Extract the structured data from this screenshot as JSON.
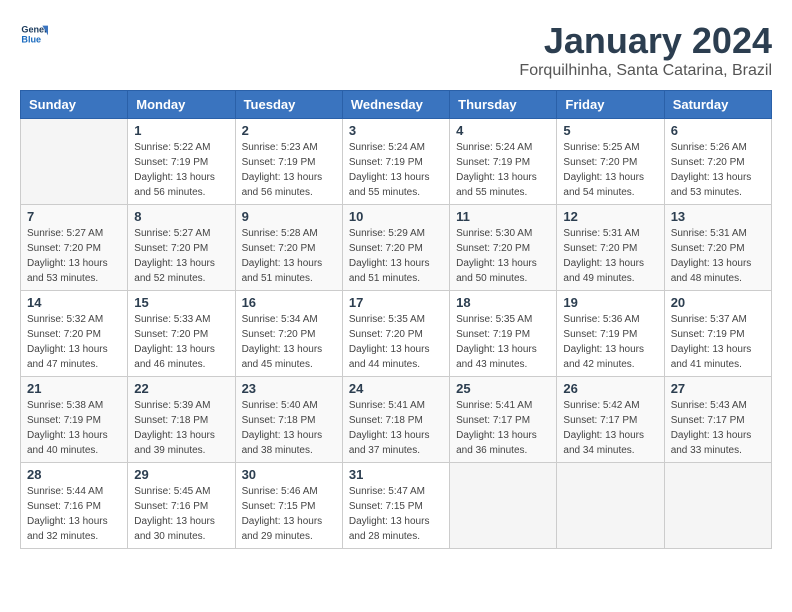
{
  "logo": {
    "line1": "General",
    "line2": "Blue"
  },
  "title": "January 2024",
  "subtitle": "Forquilhinha, Santa Catarina, Brazil",
  "headers": [
    "Sunday",
    "Monday",
    "Tuesday",
    "Wednesday",
    "Thursday",
    "Friday",
    "Saturday"
  ],
  "weeks": [
    [
      {
        "day": "",
        "sunrise": "",
        "sunset": "",
        "daylight": ""
      },
      {
        "day": "1",
        "sunrise": "Sunrise: 5:22 AM",
        "sunset": "Sunset: 7:19 PM",
        "daylight": "Daylight: 13 hours and 56 minutes."
      },
      {
        "day": "2",
        "sunrise": "Sunrise: 5:23 AM",
        "sunset": "Sunset: 7:19 PM",
        "daylight": "Daylight: 13 hours and 56 minutes."
      },
      {
        "day": "3",
        "sunrise": "Sunrise: 5:24 AM",
        "sunset": "Sunset: 7:19 PM",
        "daylight": "Daylight: 13 hours and 55 minutes."
      },
      {
        "day": "4",
        "sunrise": "Sunrise: 5:24 AM",
        "sunset": "Sunset: 7:19 PM",
        "daylight": "Daylight: 13 hours and 55 minutes."
      },
      {
        "day": "5",
        "sunrise": "Sunrise: 5:25 AM",
        "sunset": "Sunset: 7:20 PM",
        "daylight": "Daylight: 13 hours and 54 minutes."
      },
      {
        "day": "6",
        "sunrise": "Sunrise: 5:26 AM",
        "sunset": "Sunset: 7:20 PM",
        "daylight": "Daylight: 13 hours and 53 minutes."
      }
    ],
    [
      {
        "day": "7",
        "sunrise": "Sunrise: 5:27 AM",
        "sunset": "Sunset: 7:20 PM",
        "daylight": "Daylight: 13 hours and 53 minutes."
      },
      {
        "day": "8",
        "sunrise": "Sunrise: 5:27 AM",
        "sunset": "Sunset: 7:20 PM",
        "daylight": "Daylight: 13 hours and 52 minutes."
      },
      {
        "day": "9",
        "sunrise": "Sunrise: 5:28 AM",
        "sunset": "Sunset: 7:20 PM",
        "daylight": "Daylight: 13 hours and 51 minutes."
      },
      {
        "day": "10",
        "sunrise": "Sunrise: 5:29 AM",
        "sunset": "Sunset: 7:20 PM",
        "daylight": "Daylight: 13 hours and 51 minutes."
      },
      {
        "day": "11",
        "sunrise": "Sunrise: 5:30 AM",
        "sunset": "Sunset: 7:20 PM",
        "daylight": "Daylight: 13 hours and 50 minutes."
      },
      {
        "day": "12",
        "sunrise": "Sunrise: 5:31 AM",
        "sunset": "Sunset: 7:20 PM",
        "daylight": "Daylight: 13 hours and 49 minutes."
      },
      {
        "day": "13",
        "sunrise": "Sunrise: 5:31 AM",
        "sunset": "Sunset: 7:20 PM",
        "daylight": "Daylight: 13 hours and 48 minutes."
      }
    ],
    [
      {
        "day": "14",
        "sunrise": "Sunrise: 5:32 AM",
        "sunset": "Sunset: 7:20 PM",
        "daylight": "Daylight: 13 hours and 47 minutes."
      },
      {
        "day": "15",
        "sunrise": "Sunrise: 5:33 AM",
        "sunset": "Sunset: 7:20 PM",
        "daylight": "Daylight: 13 hours and 46 minutes."
      },
      {
        "day": "16",
        "sunrise": "Sunrise: 5:34 AM",
        "sunset": "Sunset: 7:20 PM",
        "daylight": "Daylight: 13 hours and 45 minutes."
      },
      {
        "day": "17",
        "sunrise": "Sunrise: 5:35 AM",
        "sunset": "Sunset: 7:20 PM",
        "daylight": "Daylight: 13 hours and 44 minutes."
      },
      {
        "day": "18",
        "sunrise": "Sunrise: 5:35 AM",
        "sunset": "Sunset: 7:19 PM",
        "daylight": "Daylight: 13 hours and 43 minutes."
      },
      {
        "day": "19",
        "sunrise": "Sunrise: 5:36 AM",
        "sunset": "Sunset: 7:19 PM",
        "daylight": "Daylight: 13 hours and 42 minutes."
      },
      {
        "day": "20",
        "sunrise": "Sunrise: 5:37 AM",
        "sunset": "Sunset: 7:19 PM",
        "daylight": "Daylight: 13 hours and 41 minutes."
      }
    ],
    [
      {
        "day": "21",
        "sunrise": "Sunrise: 5:38 AM",
        "sunset": "Sunset: 7:19 PM",
        "daylight": "Daylight: 13 hours and 40 minutes."
      },
      {
        "day": "22",
        "sunrise": "Sunrise: 5:39 AM",
        "sunset": "Sunset: 7:18 PM",
        "daylight": "Daylight: 13 hours and 39 minutes."
      },
      {
        "day": "23",
        "sunrise": "Sunrise: 5:40 AM",
        "sunset": "Sunset: 7:18 PM",
        "daylight": "Daylight: 13 hours and 38 minutes."
      },
      {
        "day": "24",
        "sunrise": "Sunrise: 5:41 AM",
        "sunset": "Sunset: 7:18 PM",
        "daylight": "Daylight: 13 hours and 37 minutes."
      },
      {
        "day": "25",
        "sunrise": "Sunrise: 5:41 AM",
        "sunset": "Sunset: 7:17 PM",
        "daylight": "Daylight: 13 hours and 36 minutes."
      },
      {
        "day": "26",
        "sunrise": "Sunrise: 5:42 AM",
        "sunset": "Sunset: 7:17 PM",
        "daylight": "Daylight: 13 hours and 34 minutes."
      },
      {
        "day": "27",
        "sunrise": "Sunrise: 5:43 AM",
        "sunset": "Sunset: 7:17 PM",
        "daylight": "Daylight: 13 hours and 33 minutes."
      }
    ],
    [
      {
        "day": "28",
        "sunrise": "Sunrise: 5:44 AM",
        "sunset": "Sunset: 7:16 PM",
        "daylight": "Daylight: 13 hours and 32 minutes."
      },
      {
        "day": "29",
        "sunrise": "Sunrise: 5:45 AM",
        "sunset": "Sunset: 7:16 PM",
        "daylight": "Daylight: 13 hours and 30 minutes."
      },
      {
        "day": "30",
        "sunrise": "Sunrise: 5:46 AM",
        "sunset": "Sunset: 7:15 PM",
        "daylight": "Daylight: 13 hours and 29 minutes."
      },
      {
        "day": "31",
        "sunrise": "Sunrise: 5:47 AM",
        "sunset": "Sunset: 7:15 PM",
        "daylight": "Daylight: 13 hours and 28 minutes."
      },
      {
        "day": "",
        "sunrise": "",
        "sunset": "",
        "daylight": ""
      },
      {
        "day": "",
        "sunrise": "",
        "sunset": "",
        "daylight": ""
      },
      {
        "day": "",
        "sunrise": "",
        "sunset": "",
        "daylight": ""
      }
    ]
  ]
}
